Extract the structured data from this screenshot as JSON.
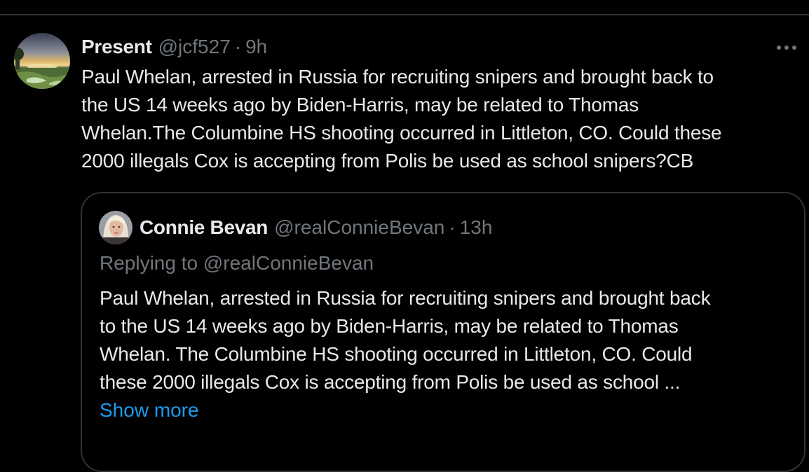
{
  "colors": {
    "background": "#000000",
    "text_primary": "#e7e9ea",
    "text_secondary": "#71767b",
    "border": "#2f3336",
    "link": "#1d9bf0"
  },
  "tweet": {
    "author_name": "Present",
    "author_handle": "@jcf527",
    "separator": "·",
    "time": "9h",
    "more_icon": "more-horizontal-icon",
    "text": "Paul Whelan, arrested in Russia for recruiting snipers and brought back to\nthe US 14 weeks ago by Biden-Harris, may be related to Thomas\nWhelan.The Columbine HS shooting occurred in Littleton, CO. Could these\n2000 illegals Cox is accepting from Polis be used as school snipers?CB"
  },
  "quote": {
    "author_name": "Connie Bevan",
    "author_handle": "@realConnieBevan",
    "separator": "·",
    "time": "13h",
    "replying_prefix": "Replying to ",
    "replying_handle": "@realConnieBevan",
    "text": "Paul Whelan, arrested in Russia for recruiting snipers and brought back\nto the US 14 weeks ago by Biden-Harris, may be related to Thomas\nWhelan. The Columbine HS shooting occurred in Littleton, CO. Could\nthese 2000 illegals Cox is accepting from Polis be used as school ...",
    "show_more": "Show more"
  }
}
